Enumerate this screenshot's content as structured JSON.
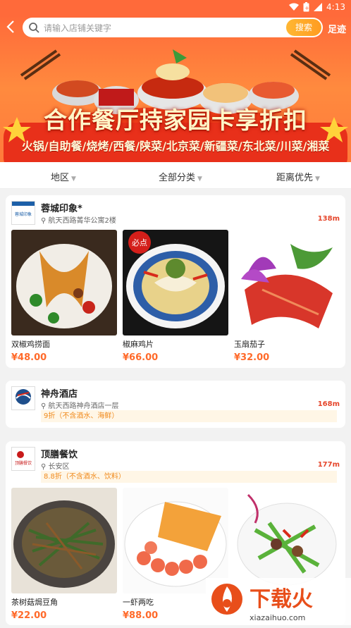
{
  "status": {
    "time": "4:13"
  },
  "search": {
    "back_icon": "back-arrow-icon",
    "placeholder": "请输入店铺关键字",
    "button": "搜索",
    "footprint": "足迹"
  },
  "banner": {
    "title": "合作餐厅持家园卡享折扣",
    "subtitle": "火锅/自助餐/烧烤/西餐/陕菜/北京菜/新疆菜/东北菜/川菜/湘菜"
  },
  "filters": [
    {
      "label": "地区"
    },
    {
      "label": "全部分类"
    },
    {
      "label": "距离优先"
    }
  ],
  "restaurants": [
    {
      "name": "蓉城印象*",
      "logo_text": "蓉城印象",
      "address": "航天西路菁华公寓2楼",
      "distance": "138m",
      "discount": "",
      "dishes": [
        {
          "name": "双椒鸡捞面",
          "price": "¥48.00"
        },
        {
          "name": "椒麻鸡片",
          "price": "¥66.00"
        },
        {
          "name": "玉扇茄子",
          "price": "¥32.00"
        }
      ]
    },
    {
      "name": "神舟酒店",
      "logo_text": "神舟酒店",
      "address": "航天西路神舟酒店一层",
      "distance": "168m",
      "discount": "9折（不含酒水、海鲜）",
      "dishes": []
    },
    {
      "name": "顶膳餐饮",
      "logo_text": "顶膳餐饮",
      "address": "长安区",
      "distance": "177m",
      "discount": "8.8折（不含酒水、饮料）",
      "dishes": [
        {
          "name": "茶树菇焗豆角",
          "price": "¥22.00"
        },
        {
          "name": "一虾两吃",
          "price": "¥88.00"
        },
        {
          "name": "",
          "price": ""
        }
      ]
    }
  ],
  "dish_badge": "必点",
  "watermark": {
    "brand": "下载火",
    "url": "xiazaihuo.com"
  },
  "colors": {
    "accent": "#ff6a3a",
    "price": "#ff6a2a",
    "discount": "#f08a1c",
    "distance": "#e5452a"
  }
}
